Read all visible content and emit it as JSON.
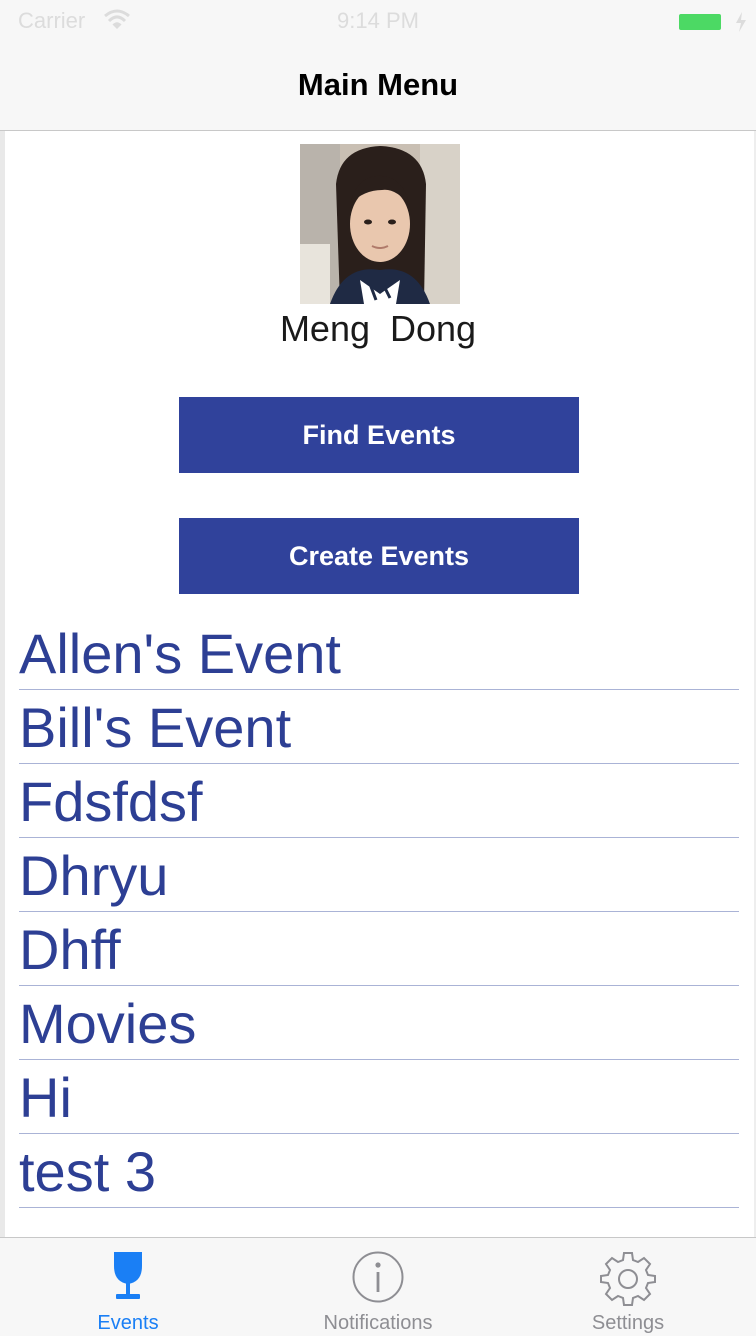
{
  "status_bar": {
    "carrier": "Carrier",
    "time": "9:14 PM",
    "battery_color": "#4cd964"
  },
  "nav": {
    "title": "Main Menu"
  },
  "profile": {
    "name": "Meng  Dong"
  },
  "buttons": {
    "find_events": "Find Events",
    "create_events": "Create Events",
    "color": "#30429b"
  },
  "events": [
    {
      "label": "Allen's Event"
    },
    {
      "label": "Bill's Event"
    },
    {
      "label": "Fdsfdsf"
    },
    {
      "label": "Dhryu"
    },
    {
      "label": "Dhff"
    },
    {
      "label": "Movies"
    },
    {
      "label": "Hi"
    },
    {
      "label": "test 3"
    }
  ],
  "tab_bar": {
    "tabs": [
      {
        "label": "Events",
        "icon": "wine-glass-icon",
        "selected": true
      },
      {
        "label": "Notifications",
        "icon": "info-circle-icon",
        "selected": false
      },
      {
        "label": "Settings",
        "icon": "gear-icon",
        "selected": false
      }
    ],
    "active_color": "#1a7ff5",
    "inactive_color": "#8e8e93"
  }
}
